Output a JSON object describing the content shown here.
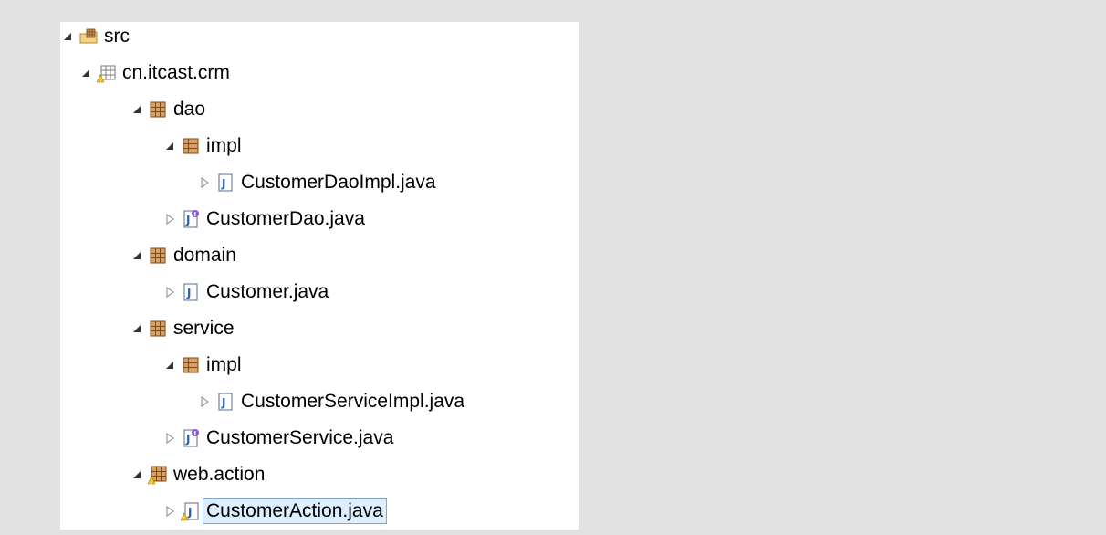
{
  "tree": [
    {
      "label": "src",
      "icon": "source-folder-icon",
      "expander": "expanded"
    },
    {
      "label": "cn.itcast.crm",
      "icon": "empty-package-warning-icon",
      "expander": "expanded"
    },
    {
      "label": "dao",
      "icon": "package-icon",
      "expander": "expanded"
    },
    {
      "label": "impl",
      "icon": "package-icon",
      "expander": "expanded"
    },
    {
      "label": "CustomerDaoImpl.java",
      "icon": "java-class-icon",
      "expander": "collapsed"
    },
    {
      "label": "CustomerDao.java",
      "icon": "java-interface-icon",
      "expander": "collapsed"
    },
    {
      "label": "domain",
      "icon": "package-icon",
      "expander": "expanded"
    },
    {
      "label": "Customer.java",
      "icon": "java-class-icon",
      "expander": "collapsed"
    },
    {
      "label": "service",
      "icon": "package-icon",
      "expander": "expanded"
    },
    {
      "label": "impl",
      "icon": "package-icon",
      "expander": "expanded"
    },
    {
      "label": "CustomerServiceImpl.java",
      "icon": "java-class-icon",
      "expander": "collapsed"
    },
    {
      "label": "CustomerService.java",
      "icon": "java-interface-icon",
      "expander": "collapsed"
    },
    {
      "label": "web.action",
      "icon": "package-warning-icon",
      "expander": "expanded"
    },
    {
      "label": "CustomerAction.java",
      "icon": "java-class-warning-icon",
      "expander": "collapsed",
      "selected": true
    }
  ]
}
